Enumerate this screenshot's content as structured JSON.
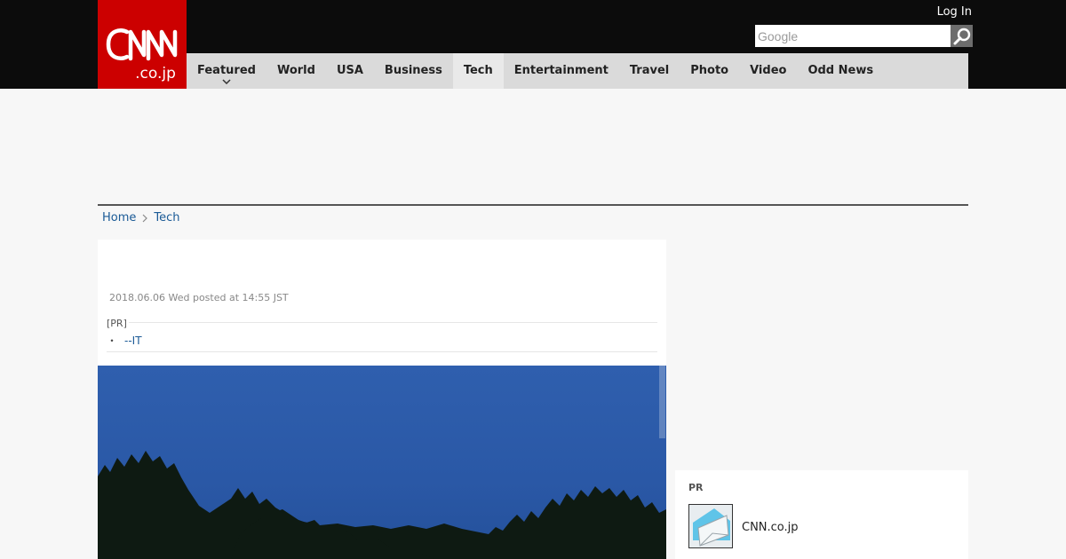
{
  "header": {
    "logo_text": "CNN",
    "logo_sub": ".co.jp",
    "login_label": "Log In",
    "search": {
      "placeholder": "Google",
      "value": ""
    }
  },
  "nav": {
    "items": [
      {
        "label": "Featured",
        "active": false,
        "has_dropdown": true
      },
      {
        "label": "World",
        "active": false
      },
      {
        "label": "USA",
        "active": false
      },
      {
        "label": "Business",
        "active": false
      },
      {
        "label": "Tech",
        "active": true
      },
      {
        "label": "Entertainment",
        "active": false
      },
      {
        "label": "Travel",
        "active": false
      },
      {
        "label": "Photo",
        "active": false
      },
      {
        "label": "Video",
        "active": false
      },
      {
        "label": "Odd News",
        "active": false
      }
    ]
  },
  "breadcrumb": {
    "home": "Home",
    "current": "Tech"
  },
  "article": {
    "date": "2018.06.06 Wed posted at 14:55 JST",
    "pr_label": "[PR]",
    "pr_link": "--IT",
    "pr_bullet": "・"
  },
  "sidebar": {
    "pr_label": "PR",
    "pr_item_text": "CNN.co.jp"
  },
  "colors": {
    "brand_red": "#cc0000",
    "topbar": "#0c0c0c",
    "nav_bg": "#dadada",
    "link": "#1a5a96"
  }
}
